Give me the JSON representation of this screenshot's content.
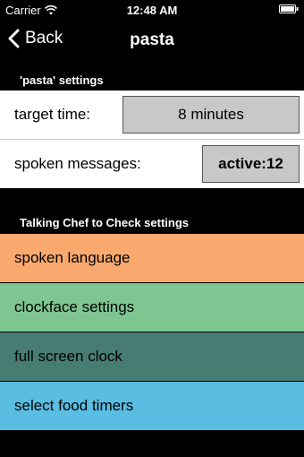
{
  "status_bar": {
    "carrier": "Carrier",
    "time": "12:48 AM",
    "wifi_icon": "wifi-icon",
    "battery_icon": "battery-icon"
  },
  "nav": {
    "back_label": "Back",
    "back_icon": "chevron-left-icon",
    "title": "pasta"
  },
  "pasta_settings": {
    "header": "'pasta' settings",
    "target_time_label": "target time:",
    "target_time_value": "8 minutes",
    "spoken_messages_label": "spoken messages:",
    "spoken_messages_value": "active:12"
  },
  "chef_settings": {
    "header": "Talking Chef to Check settings",
    "items": [
      {
        "label": "spoken language",
        "color": "#f9a96e"
      },
      {
        "label": "clockface settings",
        "color": "#7ec592"
      },
      {
        "label": "full screen clock",
        "color": "#477c72"
      },
      {
        "label": "select food timers",
        "color": "#5abde2"
      }
    ]
  }
}
